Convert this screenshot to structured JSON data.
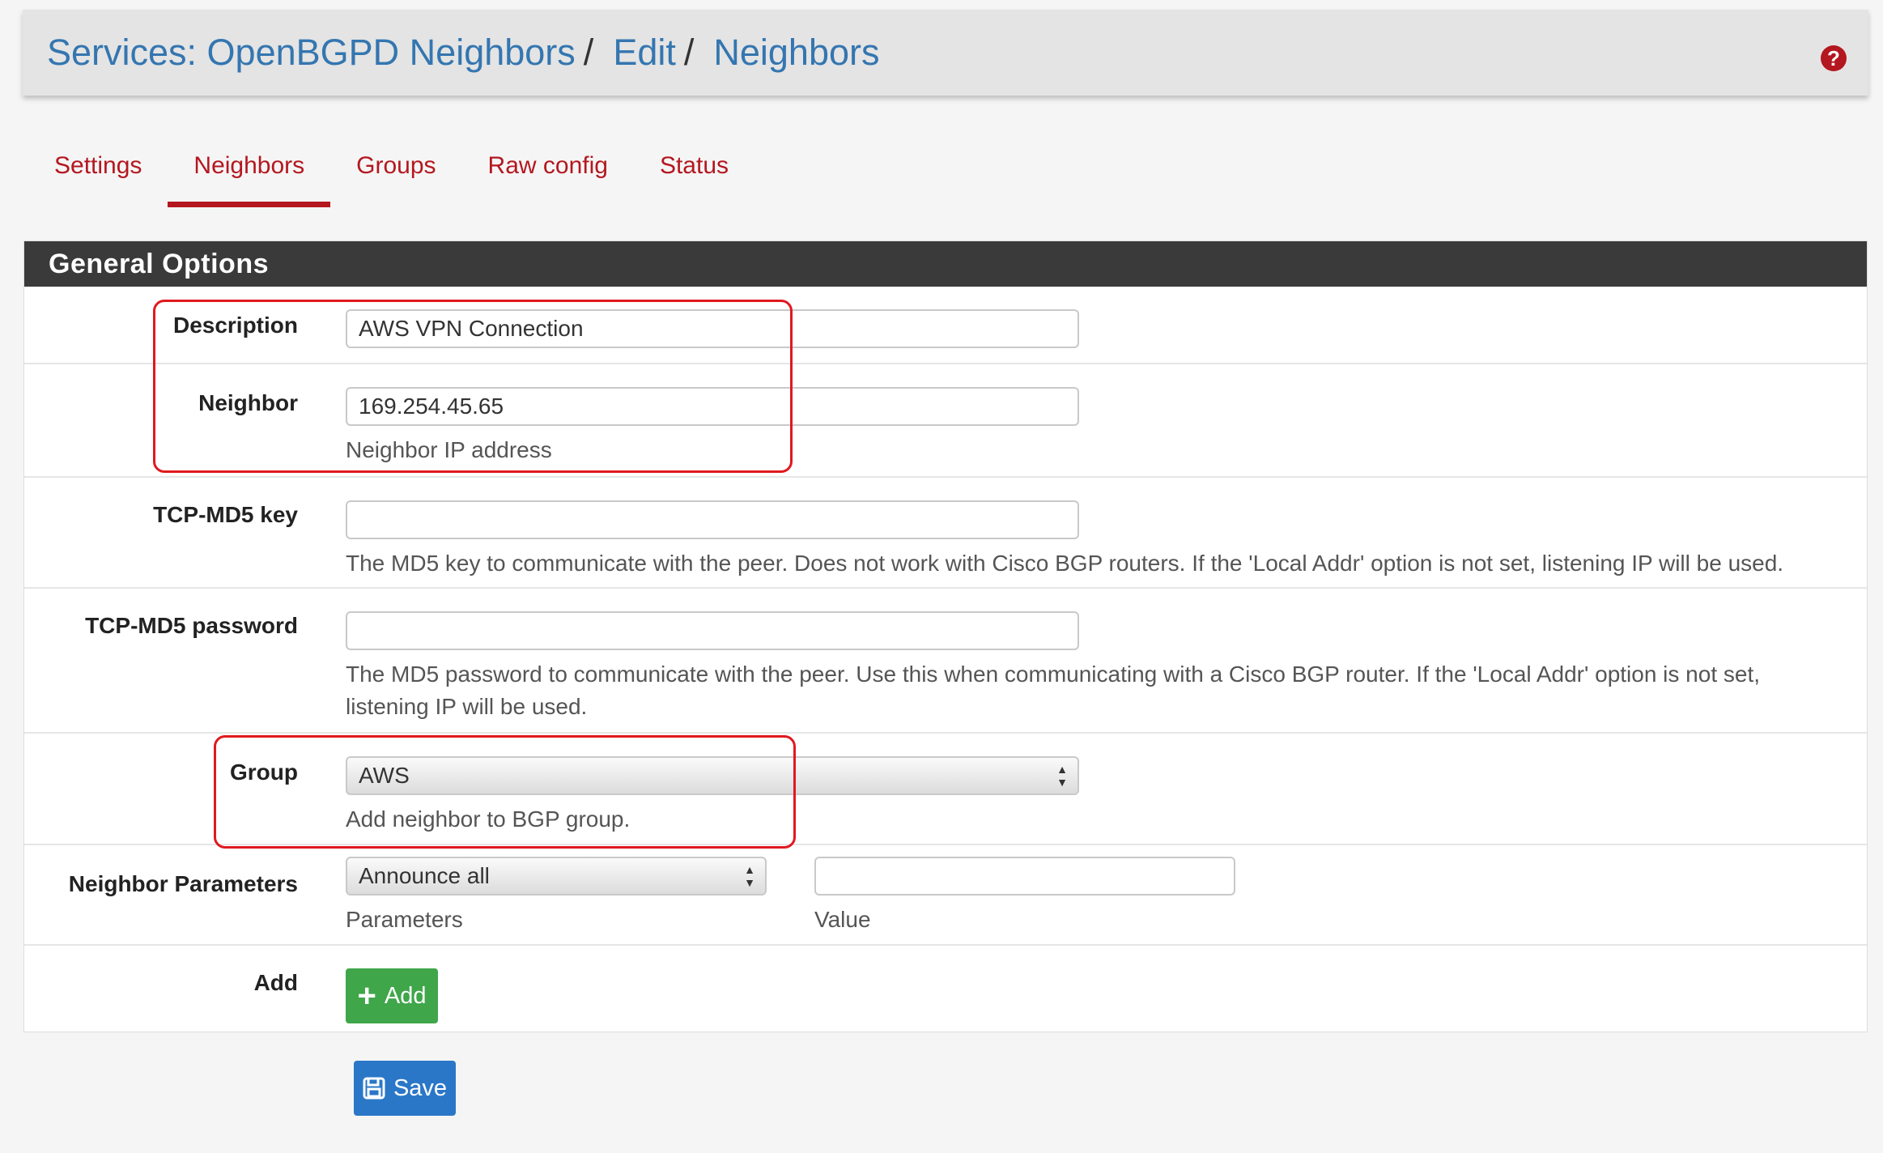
{
  "header": {
    "crumbs": [
      "Services: OpenBGPD Neighbors",
      "Edit",
      "Neighbors"
    ],
    "separator": "/",
    "help_glyph": "?"
  },
  "tabs": [
    {
      "label": "Settings",
      "active": false
    },
    {
      "label": "Neighbors",
      "active": true
    },
    {
      "label": "Groups",
      "active": false
    },
    {
      "label": "Raw config",
      "active": false
    },
    {
      "label": "Status",
      "active": false
    }
  ],
  "panel": {
    "title": "General Options",
    "description": {
      "label": "Description",
      "value": "AWS VPN Connection"
    },
    "neighbor": {
      "label": "Neighbor",
      "value": "169.254.45.65",
      "help": "Neighbor IP address"
    },
    "md5_key": {
      "label": "TCP-MD5 key",
      "value": "",
      "help": "The MD5 key to communicate with the peer. Does not work with Cisco BGP routers. If the 'Local Addr' option is not set, listening IP will be used."
    },
    "md5_password": {
      "label": "TCP-MD5 password",
      "value": "",
      "help": "The MD5 password to communicate with the peer. Use this when communicating with a Cisco BGP router. If the 'Local Addr' option is not set, listening IP will be used."
    },
    "group": {
      "label": "Group",
      "selected": "AWS",
      "help": "Add neighbor to BGP group."
    },
    "params": {
      "label": "Neighbor Parameters",
      "selected": "Announce all",
      "value": "",
      "param_help": "Parameters",
      "value_help": "Value"
    },
    "add": {
      "label": "Add",
      "button": "Add"
    }
  },
  "save_button": "Save",
  "colors": {
    "accent": "#b4171f",
    "link": "#3476b0",
    "highlight": "#e0191f",
    "add": "#3fa64a",
    "save": "#2a77c8"
  },
  "icons": {
    "help": "question-circle-icon",
    "add": "plus-icon",
    "save": "floppy-disk-icon",
    "select": "up-down-arrows-icon"
  }
}
